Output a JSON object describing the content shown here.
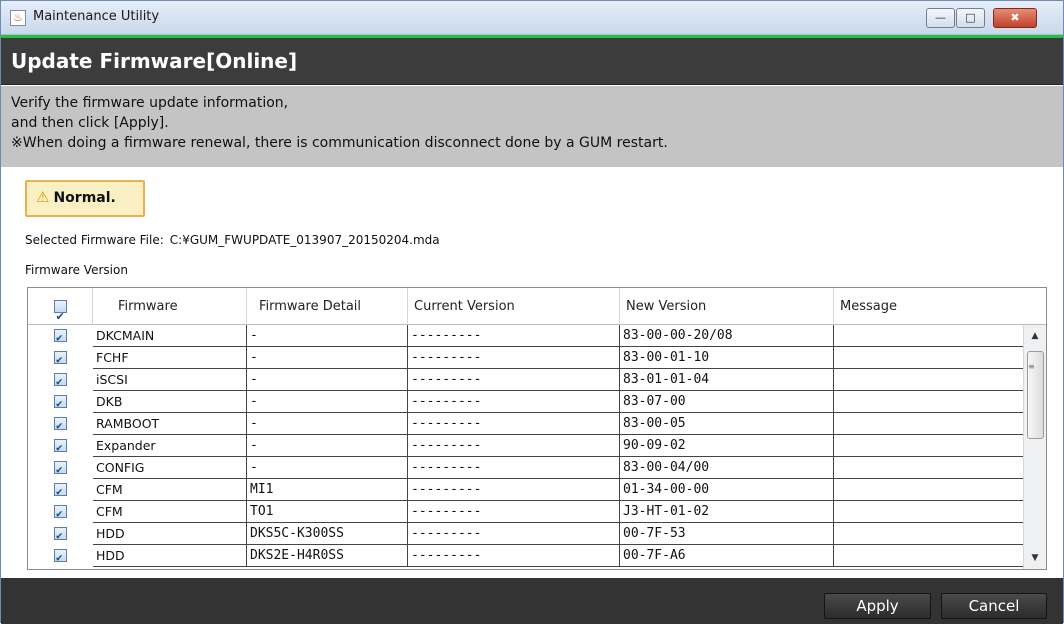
{
  "window": {
    "title": "Maintenance Utility",
    "app_icon": "java-cup-icon",
    "controls": {
      "minimize": "—",
      "maximize": "□",
      "close": "✖"
    }
  },
  "colors": {
    "accent": "#26c13a",
    "header_bg": "#3c3c3c",
    "instructions_bg": "#c4c4c4",
    "badge_bg": "#fbf0c4",
    "badge_border": "#e9b050",
    "footer_bg": "#333333"
  },
  "header": {
    "title": "Update Firmware[Online]"
  },
  "instructions": {
    "line1": "Verify the firmware update information,",
    "line2": "and then click [Apply].",
    "line3": "※When doing a firmware renewal, there is communication disconnect done by a GUM restart."
  },
  "status": {
    "icon": "warning-icon",
    "text": "Normal."
  },
  "file": {
    "label": "Selected Firmware File:",
    "value": "C:¥GUM_FWUPDATE_013907_20150204.mda"
  },
  "section_label": "Firmware Version",
  "table": {
    "columns": [
      "Firmware",
      "Firmware Detail",
      "Current Version",
      "New Version",
      "Message"
    ],
    "header_checked": true,
    "rows": [
      {
        "checked": true,
        "firmware": "DKCMAIN",
        "detail": "-",
        "current": "---------",
        "new": "83-00-00-20/08",
        "message": ""
      },
      {
        "checked": true,
        "firmware": "FCHF",
        "detail": "-",
        "current": "---------",
        "new": "83-00-01-10",
        "message": ""
      },
      {
        "checked": true,
        "firmware": "iSCSI",
        "detail": "-",
        "current": "---------",
        "new": "83-01-01-04",
        "message": ""
      },
      {
        "checked": true,
        "firmware": "DKB",
        "detail": "-",
        "current": "---------",
        "new": "83-07-00",
        "message": ""
      },
      {
        "checked": true,
        "firmware": "RAMBOOT",
        "detail": "-",
        "current": "---------",
        "new": "83-00-05",
        "message": ""
      },
      {
        "checked": true,
        "firmware": "Expander",
        "detail": "-",
        "current": "---------",
        "new": "90-09-02",
        "message": ""
      },
      {
        "checked": true,
        "firmware": "CONFIG",
        "detail": "-",
        "current": "---------",
        "new": "83-00-04/00",
        "message": ""
      },
      {
        "checked": true,
        "firmware": "CFM",
        "detail": "MI1",
        "current": "---------",
        "new": "01-34-00-00",
        "message": ""
      },
      {
        "checked": true,
        "firmware": "CFM",
        "detail": "TO1",
        "current": "---------",
        "new": "J3-HT-01-02",
        "message": ""
      },
      {
        "checked": true,
        "firmware": "HDD",
        "detail": "DKS5C-K300SS",
        "current": "---------",
        "new": "00-7F-53",
        "message": ""
      },
      {
        "checked": true,
        "firmware": "HDD",
        "detail": "DKS2E-H4R0SS",
        "current": "---------",
        "new": "00-7F-A6",
        "message": ""
      }
    ]
  },
  "buttons": {
    "apply": "Apply",
    "cancel": "Cancel"
  }
}
